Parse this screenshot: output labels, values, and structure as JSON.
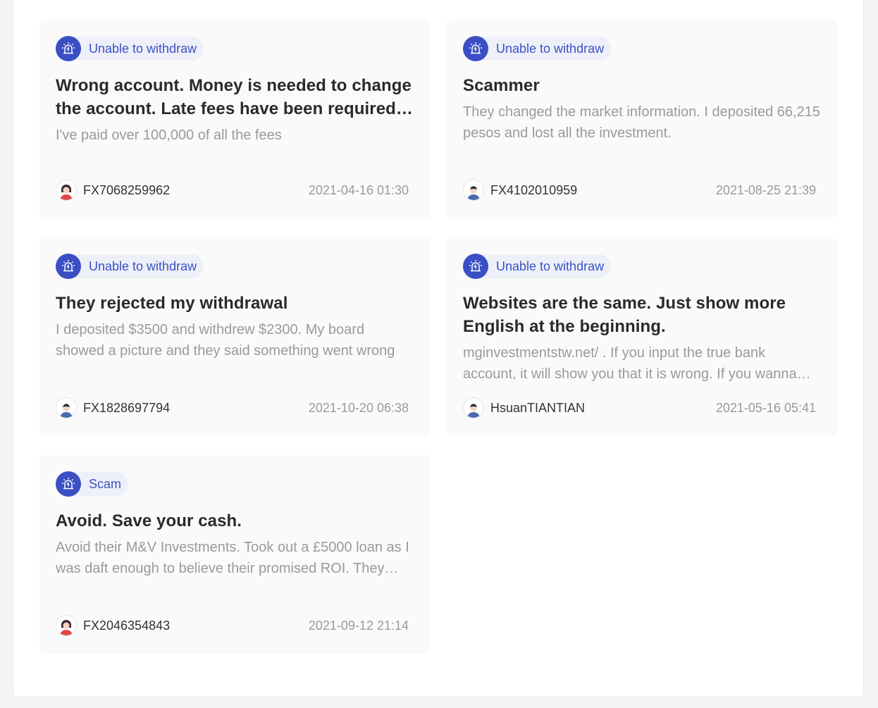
{
  "colors": {
    "accent": "#3b4fc4",
    "tag_bg": "#eef0f9",
    "card_bg": "#fafafa",
    "title": "#2a2a2a",
    "muted": "#9a9a9a"
  },
  "cards": [
    {
      "tag": "Unable to withdraw",
      "tag_icon": "alarm-icon",
      "title": "Wrong account. Money is needed to change the account. Late fees have been required to pay",
      "desc": "I've paid over 100,000 of all the fees",
      "user": "FX7068259962",
      "avatar": "female-avatar-icon",
      "date": "2021-04-16 01:30"
    },
    {
      "tag": "Unable to withdraw",
      "tag_icon": "alarm-icon",
      "title": "Scammer",
      "desc": "They changed the market information. I deposited 66,215 pesos and lost all the investment.",
      "user": "FX4102010959",
      "avatar": "male-avatar-icon",
      "date": "2021-08-25 21:39"
    },
    {
      "tag": "Unable to withdraw",
      "tag_icon": "alarm-icon",
      "title": "They rejected my withdrawal",
      "desc": "I deposited $3500 and withdrew $2300. My board showed a picture and they said something went wrong",
      "user": "FX1828697794",
      "avatar": "male-avatar-icon",
      "date": "2021-10-20 06:38"
    },
    {
      "tag": "Unable to withdraw",
      "tag_icon": "alarm-icon",
      "title": "Websites are the same. Just show more English at the beginning.",
      "desc": "mginvestmentstw.net/ . If you input the true bank account, it will show you that it is wrong. If you wanna withdraw",
      "user": "HsuanTIANTIAN",
      "avatar": "male-avatar-icon",
      "date": "2021-05-16 05:41"
    },
    {
      "tag": "Scam",
      "tag_icon": "alarm-icon",
      "title": "Avoid. Save your cash.",
      "desc": "Avoid their M&V Investments. Took out a £5000 loan as I was daft enough to believe their promised ROI. They took it",
      "user": "FX2046354843",
      "avatar": "female-avatar-icon",
      "date": "2021-09-12 21:14"
    }
  ]
}
